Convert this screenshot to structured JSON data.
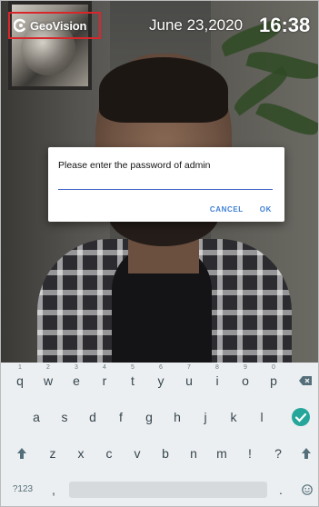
{
  "status": {
    "brand": "GeoVision",
    "date": "June 23,2020",
    "time": "16:38",
    "logo_border_color": "#d9262b"
  },
  "dialog": {
    "message": "Please enter the password of admin",
    "password_value": "",
    "cancel_label": "CANCEL",
    "ok_label": "OK",
    "accent_color": "#3f7fd6"
  },
  "keyboard": {
    "row1": [
      {
        "key": "q",
        "hint": "1"
      },
      {
        "key": "w",
        "hint": "2"
      },
      {
        "key": "e",
        "hint": "3"
      },
      {
        "key": "r",
        "hint": "4"
      },
      {
        "key": "t",
        "hint": "5"
      },
      {
        "key": "y",
        "hint": "6"
      },
      {
        "key": "u",
        "hint": "7"
      },
      {
        "key": "i",
        "hint": "8"
      },
      {
        "key": "o",
        "hint": "9"
      },
      {
        "key": "p",
        "hint": "0"
      }
    ],
    "backspace_icon": "backspace-icon",
    "row2": [
      "a",
      "s",
      "d",
      "f",
      "g",
      "h",
      "j",
      "k",
      "l"
    ],
    "enter_icon": "checkmark-enter-icon",
    "row3": [
      "z",
      "x",
      "c",
      "v",
      "b",
      "n",
      "m",
      "!",
      "?"
    ],
    "shift_icon": "shift-arrow-icon",
    "symbols_label": "?123",
    "comma_label": ",",
    "period_label": ".",
    "emoji_icon": "emoji-icon"
  }
}
